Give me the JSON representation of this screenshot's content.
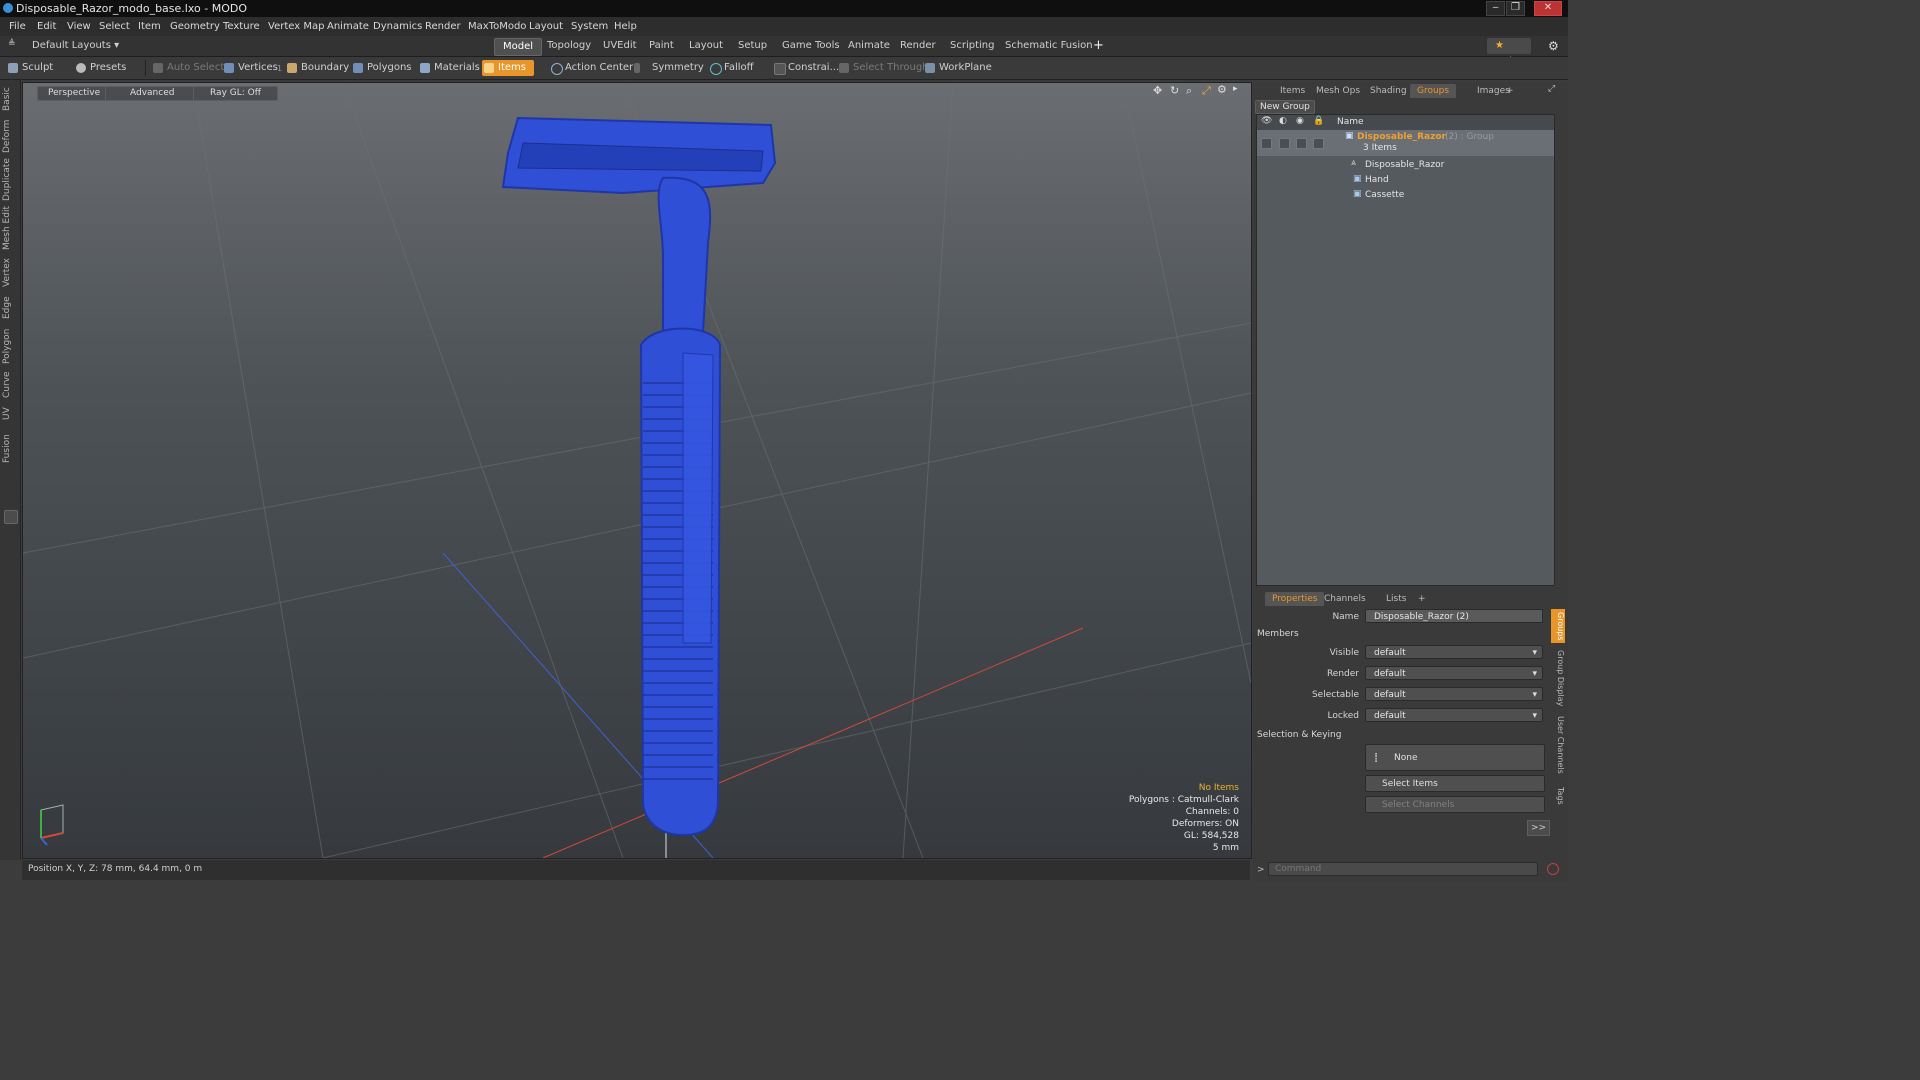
{
  "window": {
    "title": "Disposable_Razor_modo_base.lxo - MODO",
    "min": "‒",
    "max": "❐",
    "close": "✕"
  },
  "menu": [
    "File",
    "Edit",
    "View",
    "Select",
    "Item",
    "Geometry",
    "Texture",
    "Vertex Map",
    "Animate",
    "Dynamics",
    "Render",
    "MaxToModo",
    "Layout",
    "System",
    "Help"
  ],
  "layout_bar": {
    "layouts_label": "Default Layouts ▾",
    "tabs": [
      "Model",
      "Topology",
      "UVEdit",
      "Paint",
      "Layout",
      "Setup",
      "Game Tools",
      "Animate",
      "Render",
      "Scripting",
      "Schematic Fusion"
    ],
    "active_tab": "Model",
    "add_tab": "+",
    "only_label": "★ Only",
    "settings_icon": "gear-icon",
    "settings_glyph": "⚙"
  },
  "toolbar": {
    "sculpt": "Sculpt",
    "presets": "Presets",
    "auto_select": "Auto Select",
    "vertices": "Vertices",
    "vertices_count": "1",
    "boundary": "Boundary",
    "polygons": "Polygons",
    "materials": "Materials",
    "items": "Items",
    "action_center": "Action Center",
    "symmetry": "Symmetry",
    "falloff": "Falloff",
    "constraints": "Constrai...",
    "select_through": "Select Through",
    "workplane": "WorkPlane"
  },
  "left_tabs": [
    "Basic",
    "Deform",
    "Duplicate",
    "Mesh Edit",
    "Vertex",
    "Edge",
    "Polygon",
    "Curve",
    "UV",
    "Fusion"
  ],
  "viewport": {
    "perspective": "Perspective",
    "advanced": "Advanced",
    "raygl": "Ray GL: Off",
    "stats": {
      "no_items": "No Items",
      "polygons": "Polygons : Catmull-Clark",
      "channels": "Channels: 0",
      "deformers": "Deformers: ON",
      "gl": "GL: 584,528",
      "scale": "5 mm"
    },
    "colors": {
      "mesh": "#2f4fd6",
      "mesh_edge": "#1f36a8",
      "stats_highlight": "#f0b030"
    }
  },
  "status": {
    "position": "Position X, Y, Z:  78 mm, 64.4 mm, 0 m"
  },
  "groups_panel": {
    "tabs": [
      "Items",
      "Mesh Ops",
      "Shading",
      "Groups",
      "Images",
      "+"
    ],
    "active_tab": "Groups",
    "new_group": "New Group",
    "name_header": "Name",
    "group_name": "Disposable_Razor",
    "group_suffix": "(2) : Group",
    "item_count": "3 Items",
    "members": [
      "Disposable_Razor",
      "Hand",
      "Cassette"
    ]
  },
  "properties_panel": {
    "tabs": [
      "Properties",
      "Channels",
      "Lists",
      "+"
    ],
    "active_tab": "Properties",
    "name_label": "Name",
    "name_value": "Disposable_Razor (2)",
    "members_section": "Members",
    "fields": [
      {
        "label": "Visible",
        "value": "default"
      },
      {
        "label": "Render",
        "value": "default"
      },
      {
        "label": "Selectable",
        "value": "default"
      },
      {
        "label": "Locked",
        "value": "default"
      }
    ],
    "selection_section": "Selection & Keying",
    "none_button": "None",
    "select_items": "Select Items",
    "select_channels": "Select Channels",
    "more": ">>",
    "side_tabs": [
      "Groups",
      "Group Display",
      "User Channels",
      "Tags"
    ]
  },
  "command": {
    "placeholder": "Command",
    "prompt": ">"
  }
}
